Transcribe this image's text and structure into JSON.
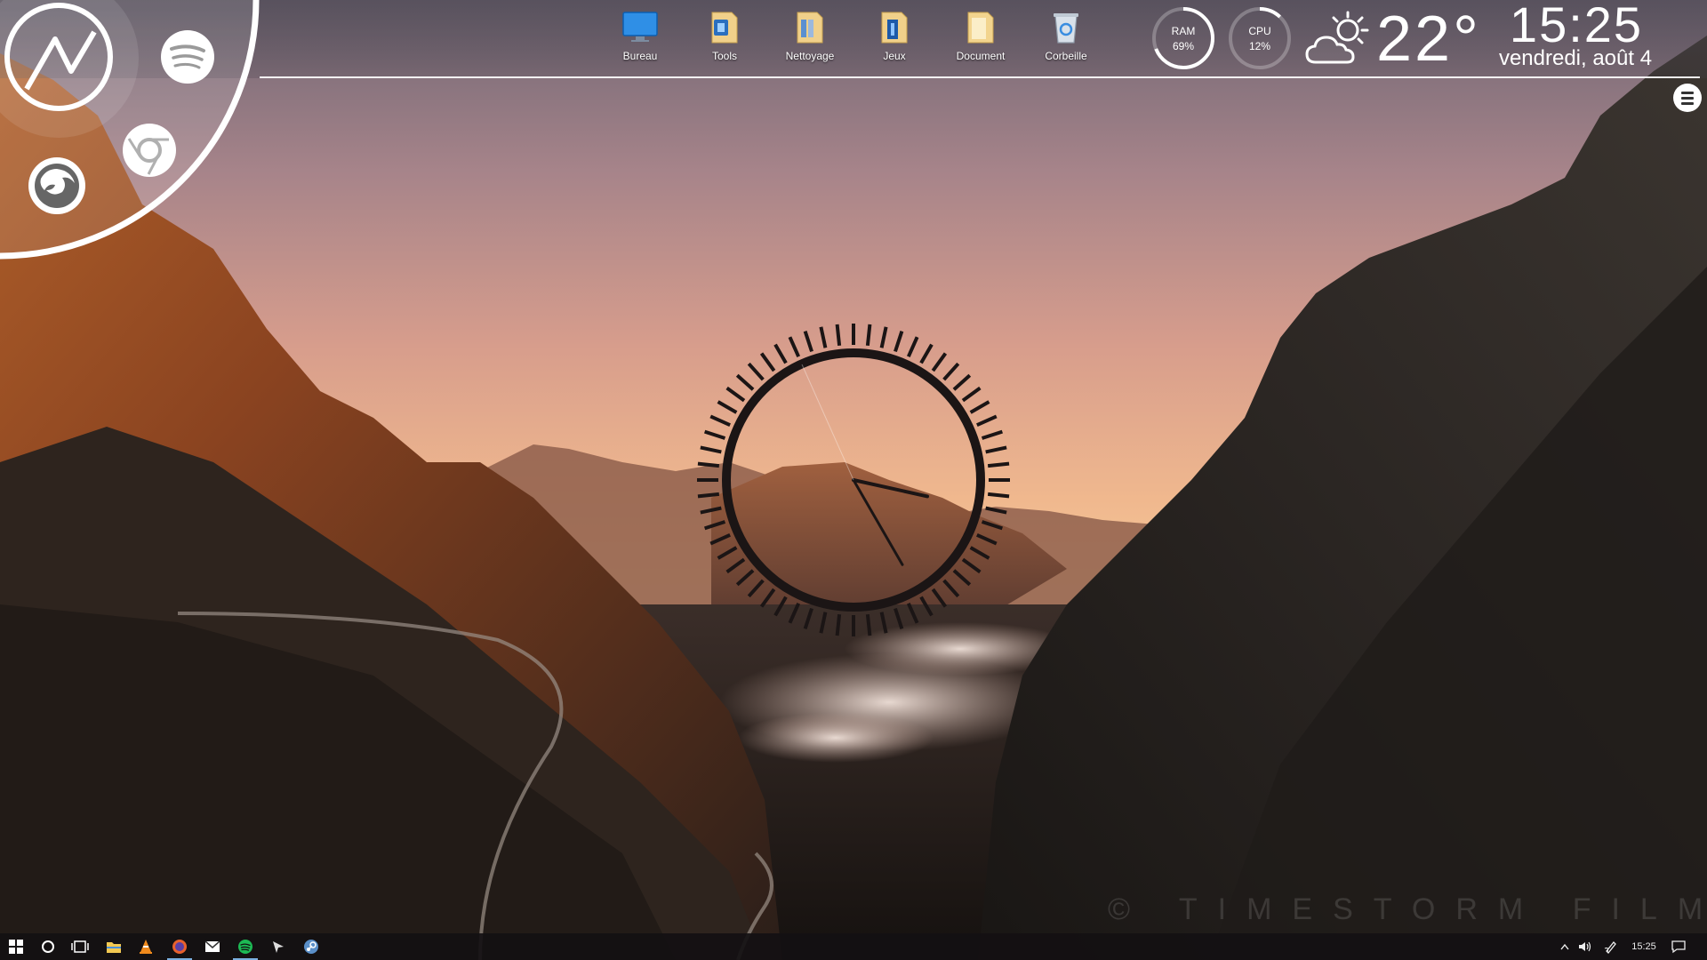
{
  "desktop_icons": [
    {
      "label": "Bureau",
      "icon": "desktop-monitor-icon"
    },
    {
      "label": "Tools",
      "icon": "tools-folder-icon"
    },
    {
      "label": "Nettoyage",
      "icon": "cleaning-folder-icon"
    },
    {
      "label": "Jeux",
      "icon": "games-folder-icon"
    },
    {
      "label": "Document",
      "icon": "document-folder-icon"
    },
    {
      "label": "Corbeille",
      "icon": "recycle-bin-icon"
    }
  ],
  "system": {
    "ram_label": "RAM",
    "ram_value": "69%",
    "ram_fraction": 0.69,
    "cpu_label": "CPU",
    "cpu_value": "12%",
    "cpu_fraction": 0.12
  },
  "weather": {
    "icon": "partly-sunny-cloud-icon",
    "temperature": "22°"
  },
  "clock": {
    "time": "15:25",
    "date": "vendredi, août 4"
  },
  "launcher": {
    "apps": [
      "activity-graph-icon",
      "spotify-icon",
      "firefox-icon",
      "chrome-icon"
    ]
  },
  "analog_clock": {
    "hour": 15,
    "minute": 25
  },
  "watermark": "© TIMESTORM FILMS",
  "taskbar": {
    "apps": [
      "windows-start-icon",
      "cortana-search-icon",
      "task-view-icon",
      "file-explorer-icon",
      "vlc-icon",
      "firefox-icon",
      "mail-icon",
      "spotify-icon",
      "pin-icon",
      "steam-icon"
    ],
    "tray_time": "15:25"
  },
  "colors": {
    "accent": "#ffffff",
    "taskbar_active": "#7bb0e0",
    "spotify": "#1db954"
  }
}
